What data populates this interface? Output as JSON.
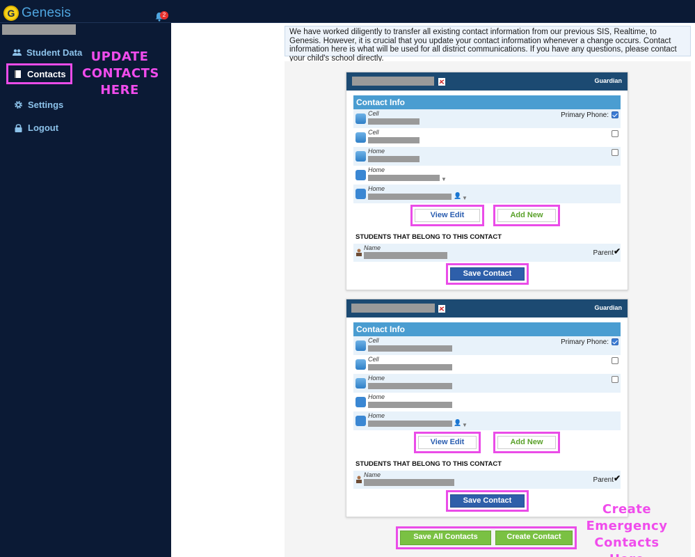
{
  "app": {
    "logo_letter": "G",
    "logo_text": "Genesis",
    "notification_count": "2"
  },
  "sidebar": {
    "items": [
      {
        "label": "Student Data"
      },
      {
        "label": "Contacts"
      },
      {
        "label": "Settings"
      },
      {
        "label": "Logout"
      }
    ]
  },
  "annotations": {
    "update_contacts": "UPDATE CONTACTS HERE",
    "create_emergency": "Create Emergency Contacts Here"
  },
  "banner": {
    "text": "We have worked diligently to transfer all existing contact information from our previous SIS, Realtime, to Genesis. However, it is crucial that you update your contact information whenever a change occurs. Contact information here is what will be used for all district communications. If you have any questions, please contact your child's school directly."
  },
  "contacts": [
    {
      "role": "Guardian",
      "section_title": "Contact Info",
      "primary_phone_label": "Primary Phone:",
      "rows": [
        {
          "type": "Cell",
          "icon": "phone-icon",
          "checked": true
        },
        {
          "type": "Cell",
          "icon": "phone-icon",
          "checked": false
        },
        {
          "type": "Home",
          "icon": "phone-icon",
          "checked": false
        },
        {
          "type": "Home",
          "icon": "mail-icon"
        },
        {
          "type": "Home",
          "icon": "mail-icon"
        }
      ],
      "view_edit_label": "View Edit",
      "add_new_label": "Add New",
      "students_heading": "STUDENTS THAT BELONG TO THIS CONTACT",
      "student_name_label": "Name",
      "student_relation": "Parent",
      "save_label": "Save Contact"
    },
    {
      "role": "Guardian",
      "section_title": "Contact Info",
      "primary_phone_label": "Primary Phone:",
      "rows": [
        {
          "type": "Cell",
          "icon": "phone-icon",
          "checked": true
        },
        {
          "type": "Cell",
          "icon": "phone-icon",
          "checked": false
        },
        {
          "type": "Home",
          "icon": "phone-icon",
          "checked": false
        },
        {
          "type": "Home",
          "icon": "mail-icon"
        },
        {
          "type": "Home",
          "icon": "mail-icon"
        }
      ],
      "view_edit_label": "View Edit",
      "add_new_label": "Add New",
      "students_heading": "STUDENTS THAT BELONG TO THIS CONTACT",
      "student_name_label": "Name",
      "student_relation": "Parent",
      "save_label": "Save Contact"
    }
  ],
  "footer": {
    "save_all_label": "Save All Contacts",
    "create_label": "Create Contact"
  },
  "colors": {
    "sidebar_bg": "#0b1a35",
    "card_header": "#1c4a72",
    "section_header": "#4a9dd1",
    "highlight": "#ea4ce8",
    "save_btn": "#2e5faa",
    "green_btn": "#7ac143"
  }
}
